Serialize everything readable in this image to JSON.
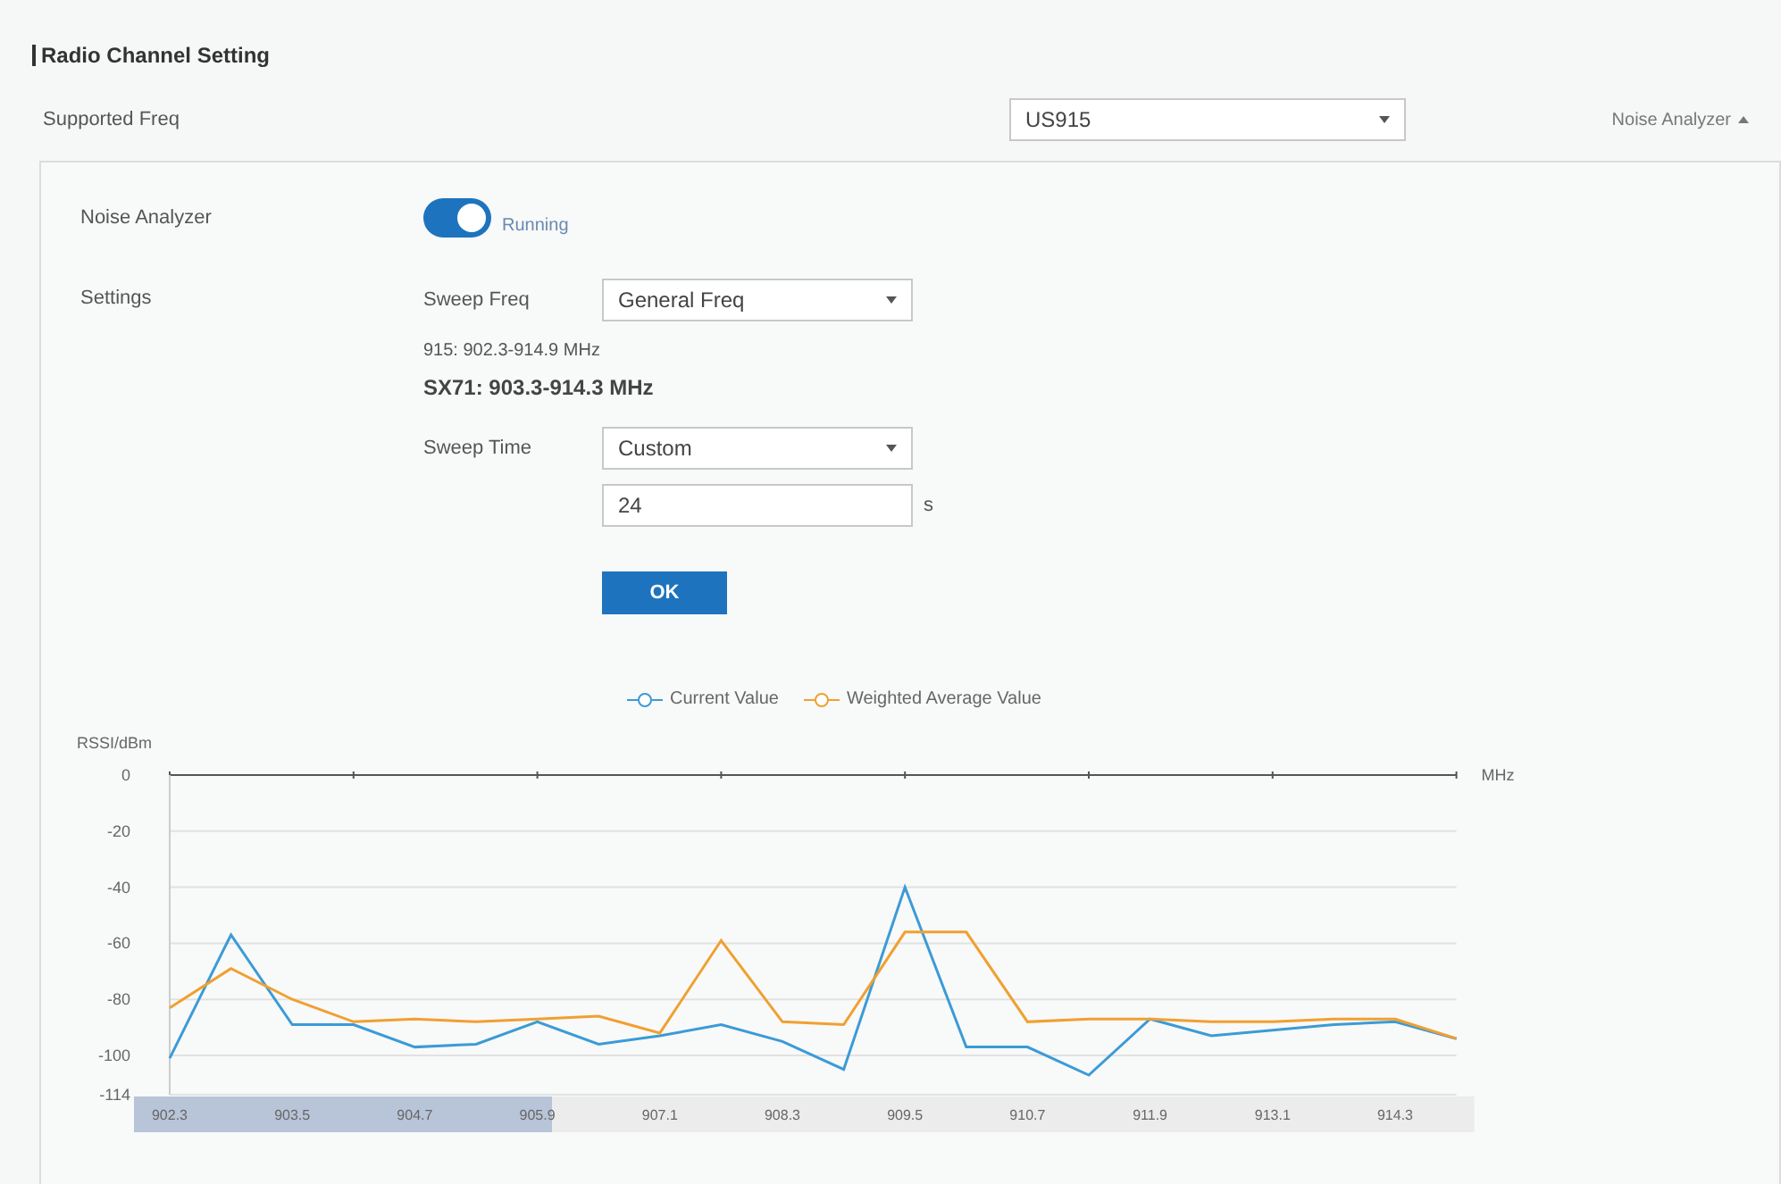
{
  "section_title": "Radio Channel Setting",
  "supported_freq": {
    "label": "Supported Freq",
    "value": "US915"
  },
  "toggle_link": {
    "label": "Noise Analyzer",
    "expanded": true
  },
  "noise_analyzer": {
    "label": "Noise Analyzer",
    "on": true,
    "status": "Running"
  },
  "settings": {
    "label": "Settings",
    "sweep_freq": {
      "label": "Sweep Freq",
      "value": "General Freq"
    },
    "info_lines": [
      "915: 902.3-914.9 MHz",
      "SX71: 903.3-914.3 MHz"
    ],
    "sweep_time": {
      "label": "Sweep Time",
      "value": "Custom"
    },
    "time_input": {
      "value": "24",
      "unit": "s"
    },
    "ok_button": "OK"
  },
  "chart_data": {
    "type": "line",
    "ylabel": "RSSI/dBm",
    "xlabel": "MHz",
    "x": [
      902.3,
      902.9,
      903.5,
      904.1,
      904.7,
      905.3,
      905.9,
      906.5,
      907.1,
      907.7,
      908.3,
      908.9,
      909.5,
      910.1,
      910.7,
      911.3,
      911.9,
      912.5,
      913.1,
      913.7,
      914.3,
      914.9
    ],
    "xticks": [
      {
        "value": 902.3,
        "label": "902.3"
      },
      {
        "value": 903.5,
        "label": "903.5"
      },
      {
        "value": 904.7,
        "label": "904.7"
      },
      {
        "value": 905.9,
        "label": "905.9"
      },
      {
        "value": 907.1,
        "label": "907.1"
      },
      {
        "value": 908.3,
        "label": "908.3"
      },
      {
        "value": 909.5,
        "label": "909.5"
      },
      {
        "value": 910.7,
        "label": "910.7"
      },
      {
        "value": 911.9,
        "label": "911.9"
      },
      {
        "value": 913.1,
        "label": "913.1"
      },
      {
        "value": 914.3,
        "label": "914.3"
      }
    ],
    "xlim": [
      902.3,
      914.9
    ],
    "grid": true,
    "series": [
      {
        "name": "Current Value",
        "color": "#3b9bd6",
        "values": [
          -101,
          -57,
          -89,
          -89,
          -97,
          -96,
          -88,
          -96,
          -93,
          -89,
          -95,
          -105,
          -40,
          -97,
          -97,
          -107,
          -87,
          -93,
          -91,
          -89,
          -88,
          -94
        ]
      },
      {
        "name": "Weighted Average Value",
        "color": "#f0a030",
        "values": [
          -83,
          -69,
          -80,
          -88,
          -87,
          -88,
          -87,
          -86,
          -92,
          -59,
          -88,
          -89,
          -56,
          -56,
          -88,
          -87,
          -87,
          -88,
          -88,
          -87,
          -87,
          -94
        ]
      }
    ],
    "ylim": [
      -114,
      0
    ],
    "yticks": [
      0,
      -20,
      -40,
      -60,
      -80,
      -100,
      -114
    ]
  }
}
